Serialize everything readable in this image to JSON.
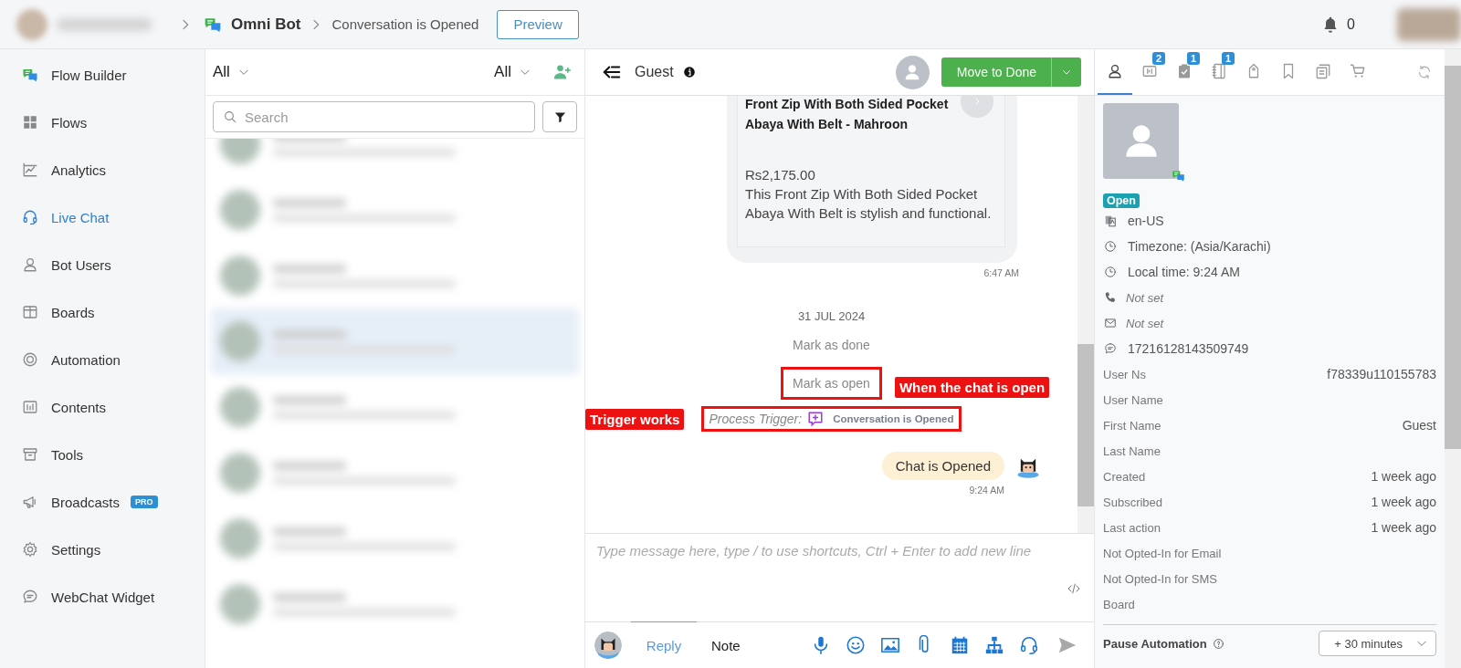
{
  "topbar": {
    "bot_name": "Omni Bot",
    "page": "Conversation is Opened",
    "preview_button": "Preview",
    "notification_count": "0"
  },
  "sidebar": {
    "items": [
      {
        "kind": "bot",
        "label": "Flow Builder",
        "selected": false
      },
      {
        "kind": "grid",
        "label": "Flows",
        "selected": false
      },
      {
        "kind": "chart",
        "label": "Analytics",
        "selected": false
      },
      {
        "kind": "headset",
        "label": "Live Chat",
        "selected": true
      },
      {
        "kind": "user",
        "label": "Bot Users",
        "selected": false
      },
      {
        "kind": "board",
        "label": "Boards",
        "selected": false
      },
      {
        "kind": "lifebuoy",
        "label": "Automation",
        "selected": false
      },
      {
        "kind": "contents",
        "label": "Contents",
        "selected": false
      },
      {
        "kind": "archive",
        "label": "Tools",
        "selected": false
      },
      {
        "kind": "megaphone",
        "label": "Broadcasts",
        "badge": "PRO",
        "selected": false
      },
      {
        "kind": "gear",
        "label": "Settings",
        "selected": false
      },
      {
        "kind": "chat",
        "label": "WebChat Widget",
        "selected": false
      }
    ]
  },
  "conversation_list": {
    "filter_left": "All",
    "filter_right": "All",
    "search_placeholder": "Search",
    "conversations": [
      {
        "selected": false
      },
      {
        "selected": false
      },
      {
        "selected": false
      },
      {
        "selected": true
      },
      {
        "selected": false
      },
      {
        "selected": false
      },
      {
        "selected": false
      },
      {
        "selected": false
      }
    ]
  },
  "chat": {
    "contact": "Guest",
    "move_button": "Move to Done",
    "product_card": {
      "title": "Front Zip With Both Sided Pocket Abaya With Belt - Mahroon",
      "price": "Rs2,175.00",
      "description": "This Front Zip With Both Sided Pocket Abaya With Belt is stylish and functional.",
      "time": "6:47 AM"
    },
    "messages": [
      {
        "kind": "date",
        "text": "31 JUL 2024",
        "highlighted": false
      },
      {
        "kind": "event",
        "text": "Mark as done",
        "highlighted": false
      },
      {
        "kind": "event",
        "text": "Mark as open",
        "highlighted": true,
        "note_after": "When the chat is open"
      },
      {
        "kind": "trigger",
        "label": "Process Trigger:",
        "text": "Conversation is Opened",
        "highlighted": true,
        "note_before": "Trigger works"
      },
      {
        "kind": "bot",
        "text": "Chat is Opened",
        "time": "9:24 AM",
        "highlighted": false
      }
    ]
  },
  "composer": {
    "placeholder": "Type message here, type / to use shortcuts, Ctrl + Enter to add new line",
    "tabs": [
      {
        "label": "Reply",
        "selected": true
      },
      {
        "label": "Note",
        "selected": false
      }
    ],
    "tools": [
      {
        "kind": "mic"
      },
      {
        "kind": "emoji"
      },
      {
        "kind": "image"
      },
      {
        "kind": "clip"
      },
      {
        "kind": "calendar"
      },
      {
        "kind": "tree"
      },
      {
        "kind": "headset"
      },
      {
        "kind": "send"
      }
    ]
  },
  "profile": {
    "tabs": [
      {
        "kind": "user",
        "selected": true
      },
      {
        "kind": "inbox",
        "badge": "2",
        "selected": false
      },
      {
        "kind": "clipboard",
        "badge": "1",
        "selected": false
      },
      {
        "kind": "notebook",
        "badge": "1",
        "selected": false
      },
      {
        "kind": "tag",
        "selected": false
      },
      {
        "kind": "bookmark",
        "selected": false
      },
      {
        "kind": "copies",
        "selected": false
      },
      {
        "kind": "cart",
        "selected": false
      }
    ],
    "status": "Open",
    "details": [
      {
        "kind": "language",
        "text": "en-US"
      },
      {
        "kind": "clock",
        "text": "Timezone: (Asia/Karachi)"
      },
      {
        "kind": "clock",
        "text": "Local time: 9:24 AM"
      },
      {
        "kind": "phone",
        "text": "Not set"
      },
      {
        "kind": "mail",
        "text": "Not set"
      },
      {
        "kind": "chat",
        "text": "17216128143509749"
      }
    ],
    "fields": [
      {
        "label": "User Ns",
        "value": "f78339u110155783"
      },
      {
        "label": "User Name"
      },
      {
        "label": "First Name",
        "value": "Guest"
      },
      {
        "label": "Last Name"
      },
      {
        "label": "Created",
        "value": "1 week ago"
      },
      {
        "label": "Subscribed",
        "value": "1 week ago"
      },
      {
        "label": "Last action",
        "value": "1 week ago"
      },
      {
        "label": "Not Opted-In for Email"
      },
      {
        "label": "Not Opted-In for SMS"
      },
      {
        "label": "Board"
      }
    ],
    "pause": {
      "label": "Pause Automation",
      "value": "+ 30 minutes"
    }
  }
}
